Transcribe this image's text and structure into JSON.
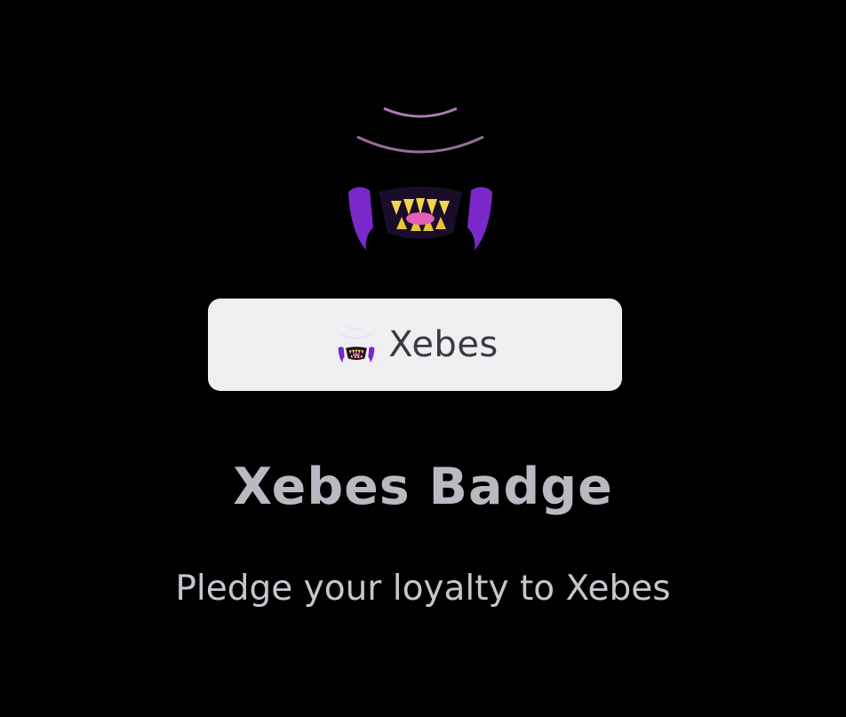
{
  "badge": {
    "emblem_icon": "xebes-emblem-icon",
    "pill_label": "Xebes",
    "title": "Xebes Badge",
    "subtitle": "Pledge your loyalty to Xebes"
  },
  "colors": {
    "background": "#000000",
    "pill_background": "#efeff2",
    "pill_text": "#3a3a3f",
    "title_text": "#b9b9c1",
    "subtitle_text": "#c6c6ce",
    "emblem_purple": "#8a2be2",
    "emblem_magenta": "#e04fe0"
  }
}
